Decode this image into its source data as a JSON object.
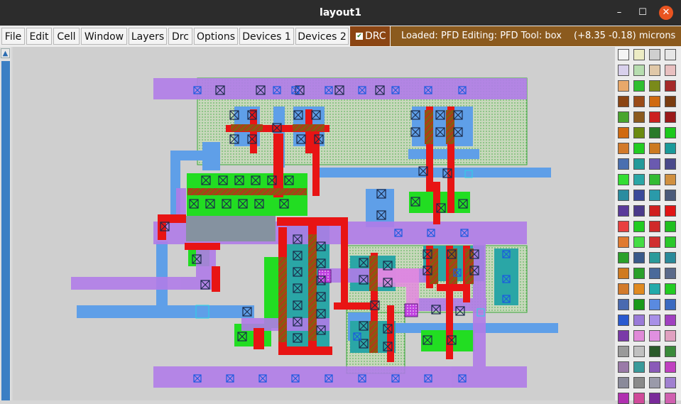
{
  "window": {
    "title": "layout1",
    "controls": {
      "minimize": "–",
      "maximize": "☐",
      "close": "✕"
    }
  },
  "menubar": {
    "items": [
      {
        "id": "file",
        "label": "File"
      },
      {
        "id": "edit",
        "label": "Edit"
      },
      {
        "id": "cell",
        "label": "Cell"
      },
      {
        "id": "window",
        "label": "Window"
      },
      {
        "id": "layers",
        "label": "Layers"
      },
      {
        "id": "drc",
        "label": "Drc"
      },
      {
        "id": "options",
        "label": "Options"
      },
      {
        "id": "devices1",
        "label": "Devices 1"
      },
      {
        "id": "devices2",
        "label": "Devices 2"
      }
    ],
    "drc_toggle": {
      "label": "DRC",
      "checked": true,
      "checkmark": "✔"
    }
  },
  "status": {
    "message": "Loaded: PFD Editing: PFD Tool: box",
    "coordinates": "(+8.35 -0.18) microns"
  },
  "scrollbar": {
    "up_arrow": "▲"
  },
  "palette": {
    "layers": [
      {
        "name": "grid-white",
        "color": "#f4f4f4"
      },
      {
        "name": "grid-yellow",
        "color": "#ecebc4"
      },
      {
        "name": "grid-gray",
        "color": "#cfcfcf"
      },
      {
        "name": "grid-light",
        "color": "#e6e6e6"
      },
      {
        "name": "outline-purple",
        "color": "#d8d0ec"
      },
      {
        "name": "dot-green",
        "color": "#b7ddb0"
      },
      {
        "name": "dot-tan",
        "color": "#e0c8a8"
      },
      {
        "name": "dot-rose",
        "color": "#e8c0c0"
      },
      {
        "name": "hatch-tan",
        "color": "#e8a86a"
      },
      {
        "name": "hatch-green",
        "color": "#2fbf2f"
      },
      {
        "name": "hatch-olive",
        "color": "#7a8a1a"
      },
      {
        "name": "hatch-darkred",
        "color": "#a52a2a"
      },
      {
        "name": "solid-brown",
        "color": "#8b4513"
      },
      {
        "name": "dot-brown",
        "color": "#9a4b18"
      },
      {
        "name": "dot-orange",
        "color": "#d06a10"
      },
      {
        "name": "solid-brown2",
        "color": "#7a3c10"
      },
      {
        "name": "dot-green2",
        "color": "#49a52e"
      },
      {
        "name": "hatch-brown",
        "color": "#8b5a1e"
      },
      {
        "name": "hatch-red",
        "color": "#cc2020"
      },
      {
        "name": "hatch-maroon",
        "color": "#9a1a1a"
      },
      {
        "name": "hatch-orange",
        "color": "#d06a10"
      },
      {
        "name": "hatch-olive2",
        "color": "#6a8a10"
      },
      {
        "name": "solid-darkgreen",
        "color": "#2a7a2a"
      },
      {
        "name": "solid-green",
        "color": "#1cc81c"
      },
      {
        "name": "solid-orange",
        "color": "#d27a2a"
      },
      {
        "name": "solid-lime",
        "color": "#22cc22"
      },
      {
        "name": "solid-orange2",
        "color": "#cc7a20"
      },
      {
        "name": "solid-teal",
        "color": "#1a9a9a"
      },
      {
        "name": "x-blue",
        "color": "#4a6fb0"
      },
      {
        "name": "x-teal",
        "color": "#239a9a"
      },
      {
        "name": "x-purple",
        "color": "#6a5ab0"
      },
      {
        "name": "x-dark",
        "color": "#4a4a8a"
      },
      {
        "name": "dot-lime",
        "color": "#33dd33"
      },
      {
        "name": "dot-teal",
        "color": "#2aa6a6"
      },
      {
        "name": "dot-green3",
        "color": "#33bb33"
      },
      {
        "name": "dot-orange3",
        "color": "#d09040"
      },
      {
        "name": "x-teal2",
        "color": "#2a8ca0"
      },
      {
        "name": "x-navy",
        "color": "#3a4a9a"
      },
      {
        "name": "x-teal3",
        "color": "#2a9aaa"
      },
      {
        "name": "x-slate",
        "color": "#4a5a7a"
      },
      {
        "name": "x-violet",
        "color": "#5a3a9a"
      },
      {
        "name": "x-indigo",
        "color": "#4a3a8a"
      },
      {
        "name": "hatch-red2",
        "color": "#d02020"
      },
      {
        "name": "solid-red",
        "color": "#e01515"
      },
      {
        "name": "solid-red2",
        "color": "#e84040"
      },
      {
        "name": "solid-green2",
        "color": "#22cc22"
      },
      {
        "name": "dot-red",
        "color": "#d02a2a"
      },
      {
        "name": "solid-green3",
        "color": "#1fbf1f"
      },
      {
        "name": "solid-orange4",
        "color": "#e07a30"
      },
      {
        "name": "dot-lime2",
        "color": "#44dd44"
      },
      {
        "name": "solid-red3",
        "color": "#d03030"
      },
      {
        "name": "solid-green4",
        "color": "#2ac82a"
      },
      {
        "name": "x-green",
        "color": "#2aa02a"
      },
      {
        "name": "x-slate2",
        "color": "#3a5a8a"
      },
      {
        "name": "x-teal4",
        "color": "#2a9a9a"
      },
      {
        "name": "x-teal5",
        "color": "#2a8a9a"
      },
      {
        "name": "hatch-orange2",
        "color": "#d07a20"
      },
      {
        "name": "hatch-green2",
        "color": "#2aa02a"
      },
      {
        "name": "x-steel",
        "color": "#4a6a9a"
      },
      {
        "name": "x-slate3",
        "color": "#5a6a8a"
      },
      {
        "name": "solid-orange5",
        "color": "#d27a2a"
      },
      {
        "name": "solid-orange6",
        "color": "#e08a20"
      },
      {
        "name": "solid-teal2",
        "color": "#22aaaa"
      },
      {
        "name": "solid-green5",
        "color": "#22cc22"
      },
      {
        "name": "x-blue2",
        "color": "#4a6ab0"
      },
      {
        "name": "hatch-green3",
        "color": "#1a9a1a"
      },
      {
        "name": "solid-blue",
        "color": "#5a8ae0"
      },
      {
        "name": "x-blue3",
        "color": "#3a6ac0"
      },
      {
        "name": "x-blue4",
        "color": "#2a5ad0"
      },
      {
        "name": "dot-violet",
        "color": "#9a7ad8"
      },
      {
        "name": "solid-lavender",
        "color": "#a890e8"
      },
      {
        "name": "x-magenta",
        "color": "#a040c0"
      },
      {
        "name": "dot-purple",
        "color": "#7a3aa8"
      },
      {
        "name": "solid-pink",
        "color": "#e08ad8"
      },
      {
        "name": "solid-pink2",
        "color": "#e090e0"
      },
      {
        "name": "dot-pink",
        "color": "#e0a0c0"
      },
      {
        "name": "solid-gray",
        "color": "#9a9a9a"
      },
      {
        "name": "x-lightgray",
        "color": "#c0c0c0"
      },
      {
        "name": "hatch-darkgreen",
        "color": "#2a5a2a"
      },
      {
        "name": "x-green2",
        "color": "#3a8a3a"
      },
      {
        "name": "x-mauve",
        "color": "#9a7aa8"
      },
      {
        "name": "solid-teal3",
        "color": "#3a9a9a"
      },
      {
        "name": "solid-purple",
        "color": "#8a5ab8"
      },
      {
        "name": "hatch-magenta",
        "color": "#c040c0"
      },
      {
        "name": "x-gray",
        "color": "#8a8a9a"
      },
      {
        "name": "solid-gray2",
        "color": "#8a8a8a"
      },
      {
        "name": "x-gray2",
        "color": "#9a9aaa"
      },
      {
        "name": "solid-lavender2",
        "color": "#a080d0"
      },
      {
        "name": "solid-magenta",
        "color": "#b030b0"
      },
      {
        "name": "solid-pink3",
        "color": "#d04a9a"
      },
      {
        "name": "solid-purple2",
        "color": "#7a2a9a"
      },
      {
        "name": "solid-pink4",
        "color": "#d060b0"
      }
    ]
  }
}
